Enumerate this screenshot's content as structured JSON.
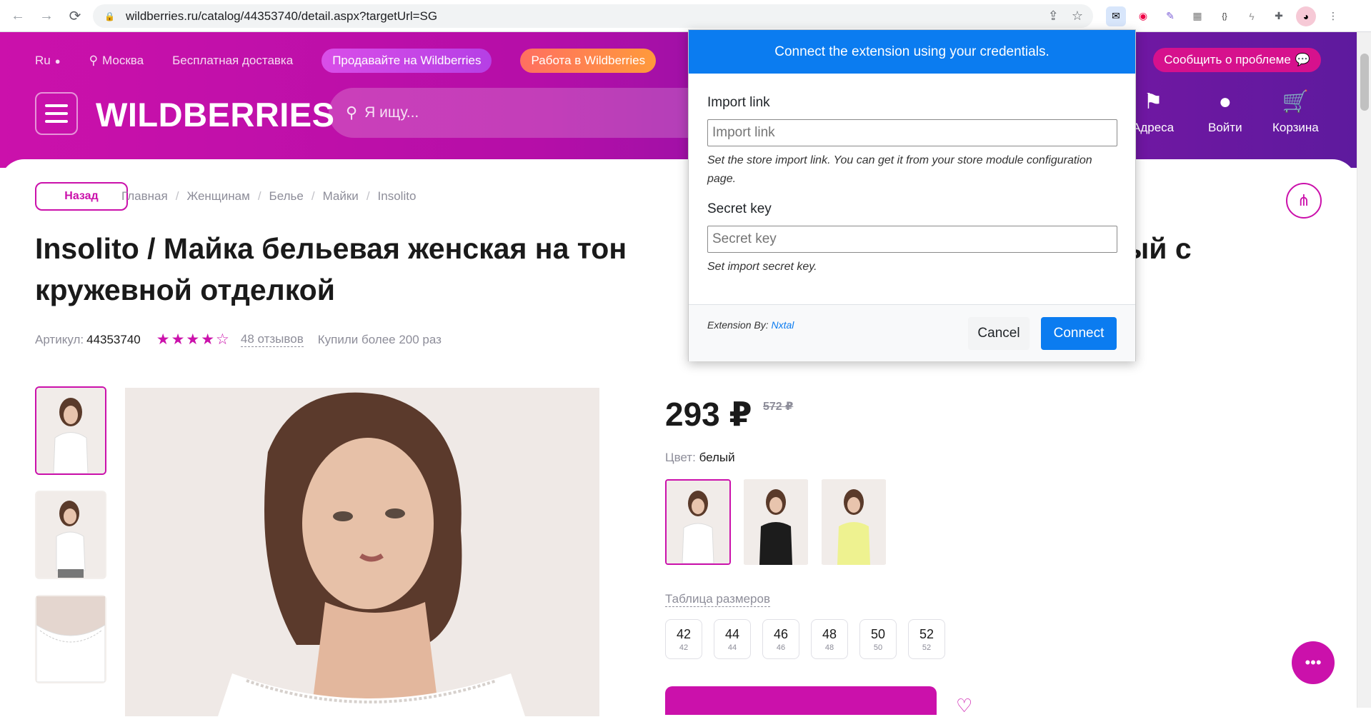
{
  "browser": {
    "url": "wildberries.ru/catalog/44353740/detail.aspx?targetUrl=SG",
    "back_icon": "arrow-left",
    "forward_icon": "arrow-right",
    "reload_icon": "reload"
  },
  "header": {
    "lang": "Ru",
    "city": "Москва",
    "free_delivery": "Бесплатная доставка",
    "sell_label": "Продавайте на Wildberries",
    "work_label": "Работа в Wildberries",
    "report_label": "Сообщить о проблеме",
    "logo": "WILDBERRIES",
    "search_placeholder": "Я ищу...",
    "addresses": "Адреса",
    "login": "Войти",
    "cart": "Корзина"
  },
  "breadcrumbs": [
    "Главная",
    "Женщинам",
    "Белье",
    "Майки",
    "Insolito"
  ],
  "back_label": "Назад",
  "product": {
    "title": "Insolito / Майка бельевая женская на тон… базовый с кружевной отделкой",
    "title_left": "Insolito / Майка бельевая женская на тон",
    "title_right": "базовый с",
    "title_line2": "кружевной отделкой",
    "article_label": "Артикул:",
    "article": "44353740",
    "rating": 4,
    "reviews": "48 отзывов",
    "bought": "Купили более 200 раз",
    "price": "293 ₽",
    "old_price": "572 ₽",
    "color_label": "Цвет:",
    "color": "белый",
    "size_table": "Таблица размеров",
    "sizes": [
      {
        "n": "42",
        "s": "42"
      },
      {
        "n": "44",
        "s": "44"
      },
      {
        "n": "46",
        "s": "46"
      },
      {
        "n": "48",
        "s": "48"
      },
      {
        "n": "50",
        "s": "50"
      },
      {
        "n": "52",
        "s": "52"
      }
    ]
  },
  "popup": {
    "header": "Connect the extension using your credentials.",
    "import_label": "Import link",
    "import_placeholder": "Import link",
    "import_hint": "Set the store import link. You can get it from your store module configuration page.",
    "secret_label": "Secret key",
    "secret_placeholder": "Secret key",
    "secret_hint": "Set import secret key.",
    "by_label": "Extension By:",
    "by_link": "Nxtal",
    "cancel": "Cancel",
    "connect": "Connect"
  },
  "colors": {
    "brand": "#cb11ab",
    "popup_blue": "#0b7cf0"
  }
}
